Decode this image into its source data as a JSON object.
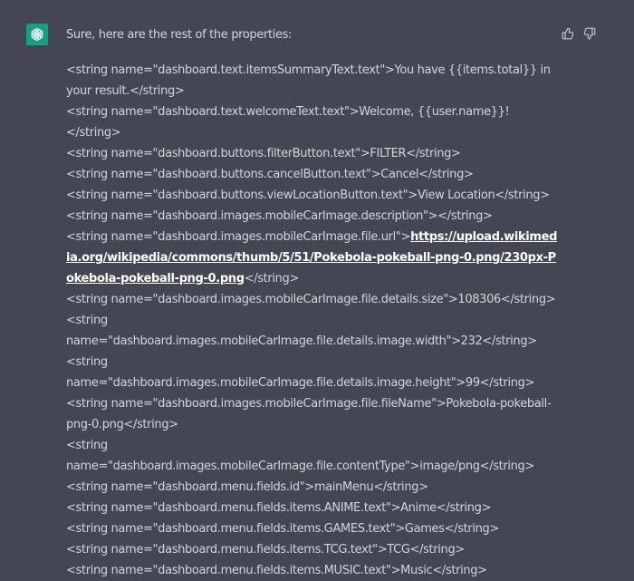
{
  "assistant": {
    "intro": "Sure, here are the rest of the properties:"
  },
  "lines": [
    "<string name=\"dashboard.text.itemsSummaryText.text\">You have {{items.total}} in your result.</string>",
    "<string name=\"dashboard.text.welcomeText.text\">Welcome, {{user.name}}!</string>",
    "<string name=\"dashboard.buttons.filterButton.text\">FILTER</string>",
    "<string name=\"dashboard.buttons.cancelButton.text\">Cancel</string>",
    "<string name=\"dashboard.buttons.viewLocationButton.text\">View Location</string>",
    "<string name=\"dashboard.images.mobileCarImage.description\"></string>"
  ],
  "url_line": {
    "prefix": "<string name=\"dashboard.images.mobileCarImage.file.url\">",
    "url": "https://upload.wikimedia.org/wikipedia/commons/thumb/5/51/Pokebola-pokeball-png-0.png/230px-Pokebola-pokeball-png-0.png",
    "suffix": "</string>"
  },
  "lines_after": [
    "<string name=\"dashboard.images.mobileCarImage.file.details.size\">108306</string>",
    "<string name=\"dashboard.images.mobileCarImage.file.details.image.width\">232</string>",
    "<string name=\"dashboard.images.mobileCarImage.file.details.image.height\">99</string>",
    "<string name=\"dashboard.images.mobileCarImage.file.fileName\">Pokebola-pokeball-png-0.png</string>",
    "<string name=\"dashboard.images.mobileCarImage.file.contentType\">image/png</string>",
    "<string name=\"dashboard.menu.fields.id\">mainMenu</string>",
    "<string name=\"dashboard.menu.fields.items.ANIME.text\">Anime</string>",
    "<string name=\"dashboard.menu.fields.items.GAMES.text\">Games</string>",
    "<string name=\"dashboard.menu.fields.items.TCG.text\">TCG</string>",
    "<string name=\"dashboard.menu.fields.items.MUSIC.text\">Music</string>"
  ],
  "icons": {
    "avatar": "openai-logo-icon",
    "thumbs_up": "thumbs-up-icon",
    "thumbs_down": "thumbs-down-icon"
  },
  "colors": {
    "background": "#444654",
    "avatar": "#10a37f",
    "text": "#d1d5db",
    "link": "#ffffff"
  }
}
